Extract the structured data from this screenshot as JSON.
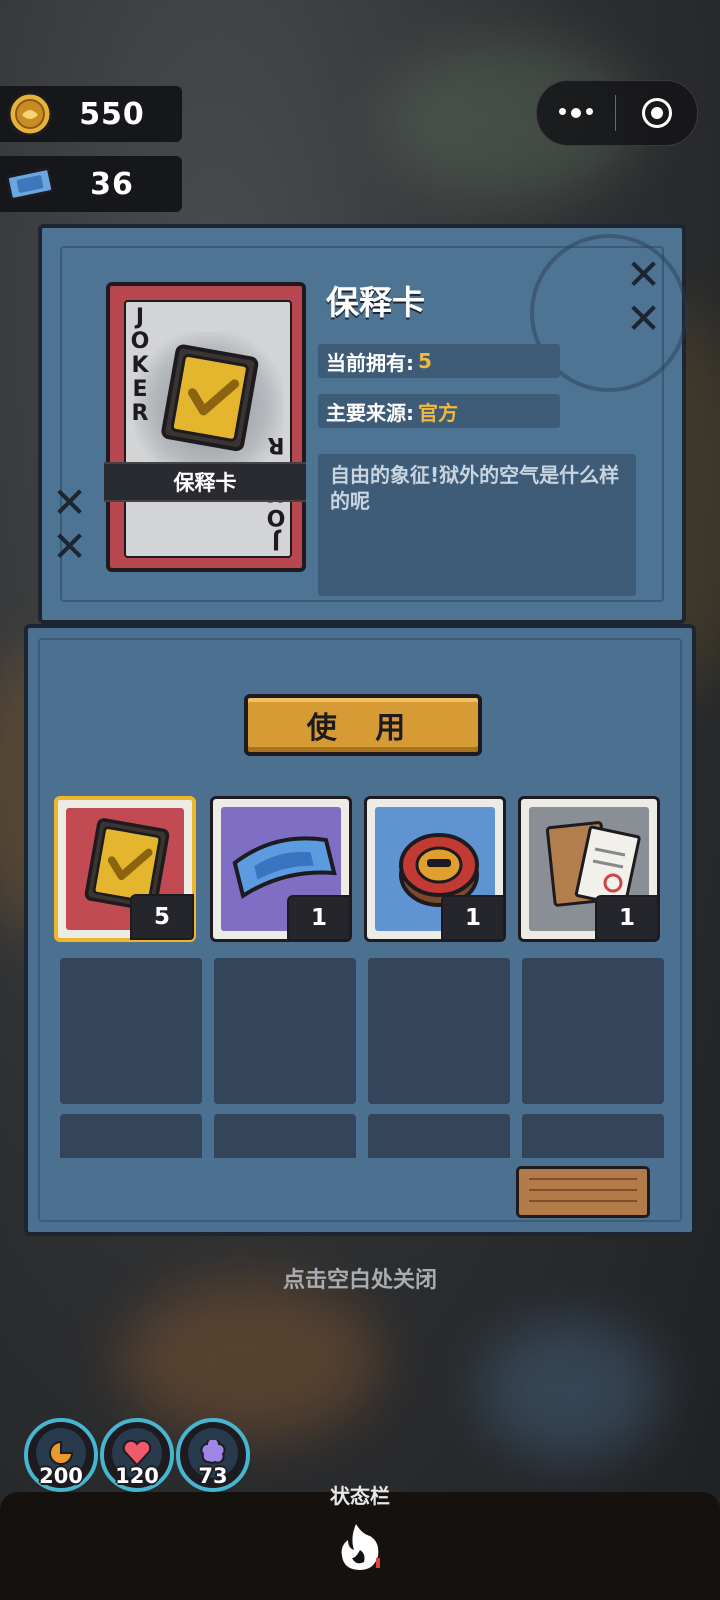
{
  "currency": {
    "coins": "550",
    "tickets": "36"
  },
  "capsule": {
    "more_icon": "more-dots-icon",
    "close_icon": "target-close-icon"
  },
  "item_detail": {
    "card_corner_text": "JOKER",
    "card_label": "保释卡",
    "title": "保释卡",
    "owned_label": "当前拥有:",
    "owned_value": "5",
    "source_label": "主要来源:",
    "source_value": "官方",
    "description": "自由的象征!狱外的空气是什么样的呢"
  },
  "use_button": "使 用",
  "inventory": [
    {
      "name": "bail-card",
      "icon": "bail-card-icon",
      "count": "5",
      "bg": "#c24a52",
      "selected": true
    },
    {
      "name": "blue-ticket",
      "icon": "blue-ticket-icon",
      "count": "1",
      "bg": "#7f6fc4",
      "selected": false
    },
    {
      "name": "red-badge",
      "icon": "red-badge-icon",
      "count": "1",
      "bg": "#5f93d2",
      "selected": false
    },
    {
      "name": "envelope-document",
      "icon": "envelope-document-icon",
      "count": "1",
      "bg": "#8a8f96",
      "selected": false
    }
  ],
  "close_hint": "点击空白处关闭",
  "stats": [
    {
      "name": "hunger",
      "icon": "food-icon",
      "value": "200",
      "color": "#e89b2c"
    },
    {
      "name": "health",
      "icon": "heart-icon",
      "value": "120",
      "color": "#ef5a6c"
    },
    {
      "name": "mind",
      "icon": "brain-icon",
      "value": "73",
      "color": "#9f86e6"
    }
  ],
  "status_bar_label": "状态栏",
  "colors": {
    "panel": "#4e7494",
    "accent_gold": "#f1b83a",
    "use_button": "#d79b35",
    "selected_border": "#f0b629"
  }
}
